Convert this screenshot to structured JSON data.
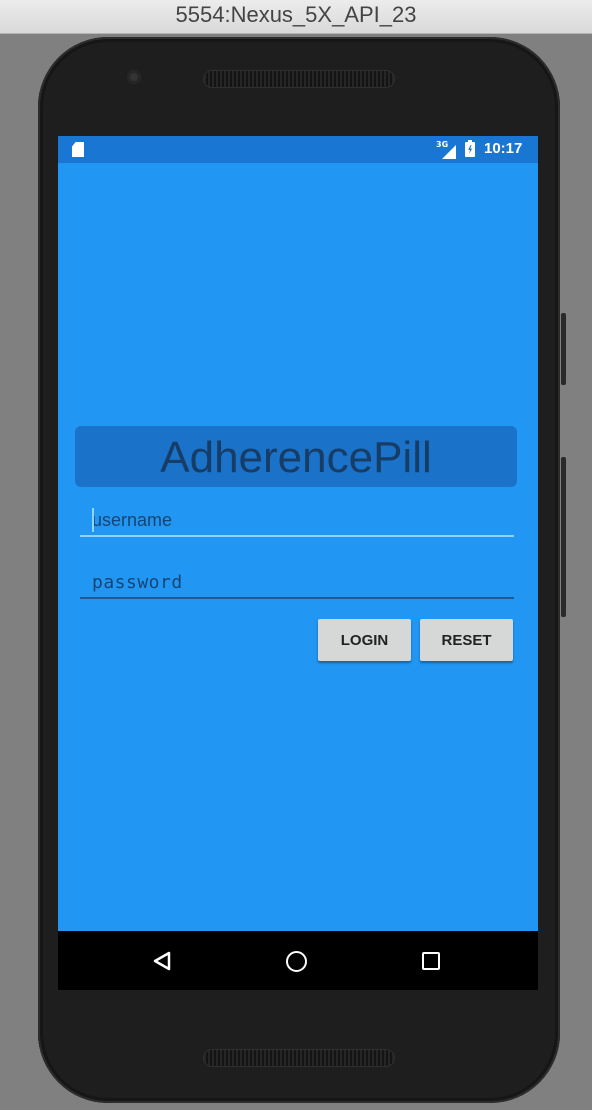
{
  "window": {
    "title": "5554:Nexus_5X_API_23"
  },
  "status_bar": {
    "time": "10:17",
    "network": "3G",
    "icons": [
      "sd-card-icon",
      "signal-icon",
      "battery-charging-icon"
    ]
  },
  "app": {
    "title": "AdherencePill",
    "username_placeholder": "username",
    "password_placeholder": "password",
    "login_label": "LOGIN",
    "reset_label": "RESET"
  },
  "nav_bar": {
    "icons": [
      "back-icon",
      "home-icon",
      "recent-apps-icon"
    ]
  },
  "colors": {
    "app_background": "#2196f3",
    "status_bar": "#1976d2",
    "title_box": "#1a73c9",
    "button": "#d6d7d7"
  }
}
